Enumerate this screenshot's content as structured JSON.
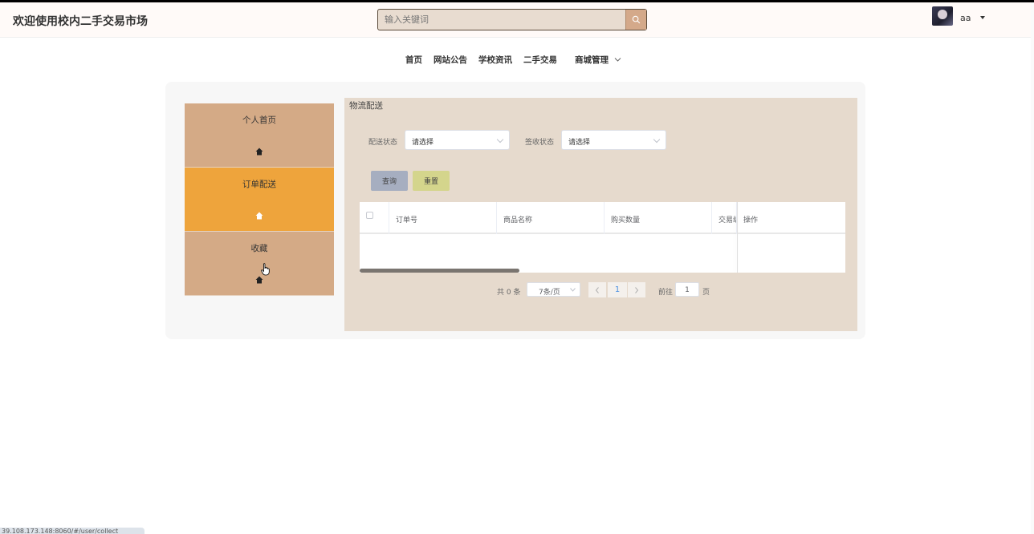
{
  "header": {
    "site_title": "欢迎使用校内二手交易市场",
    "search_placeholder": "输入关键词",
    "username": "aa"
  },
  "nav": {
    "items": [
      "首页",
      "网站公告",
      "学校资讯",
      "二手交易",
      "商城管理"
    ]
  },
  "sidebar": {
    "items": [
      {
        "label": "个人首页",
        "icon": "home-icon",
        "active": false
      },
      {
        "label": "订单配送",
        "icon": "home-icon",
        "active": true
      },
      {
        "label": "收藏",
        "icon": "home-icon",
        "active": false
      }
    ]
  },
  "content": {
    "title": "物流配送",
    "filters": {
      "delivery_status_label": "配送状态",
      "delivery_status_value": "请选择",
      "receipt_status_label": "签收状态",
      "receipt_status_value": "请选择"
    },
    "buttons": {
      "query": "查询",
      "reset": "重置"
    },
    "table": {
      "columns": [
        "订单号",
        "商品名称",
        "购买数量",
        "交易编号",
        "操作"
      ]
    },
    "pagination": {
      "total": "共 0 条",
      "page_size": "7条/页",
      "current_page": "1",
      "goto_label": "前往",
      "goto_value": "1",
      "page_unit": "页"
    }
  },
  "status_bar": {
    "url": "39.108.173.148:8060/#/user/collect"
  },
  "colors": {
    "sidebar": "#d4aa86",
    "sidebar_active": "#eea43c",
    "content_bg": "#e6dacd",
    "query_button": "#a6aec0",
    "reset_button": "#d4d58c"
  }
}
